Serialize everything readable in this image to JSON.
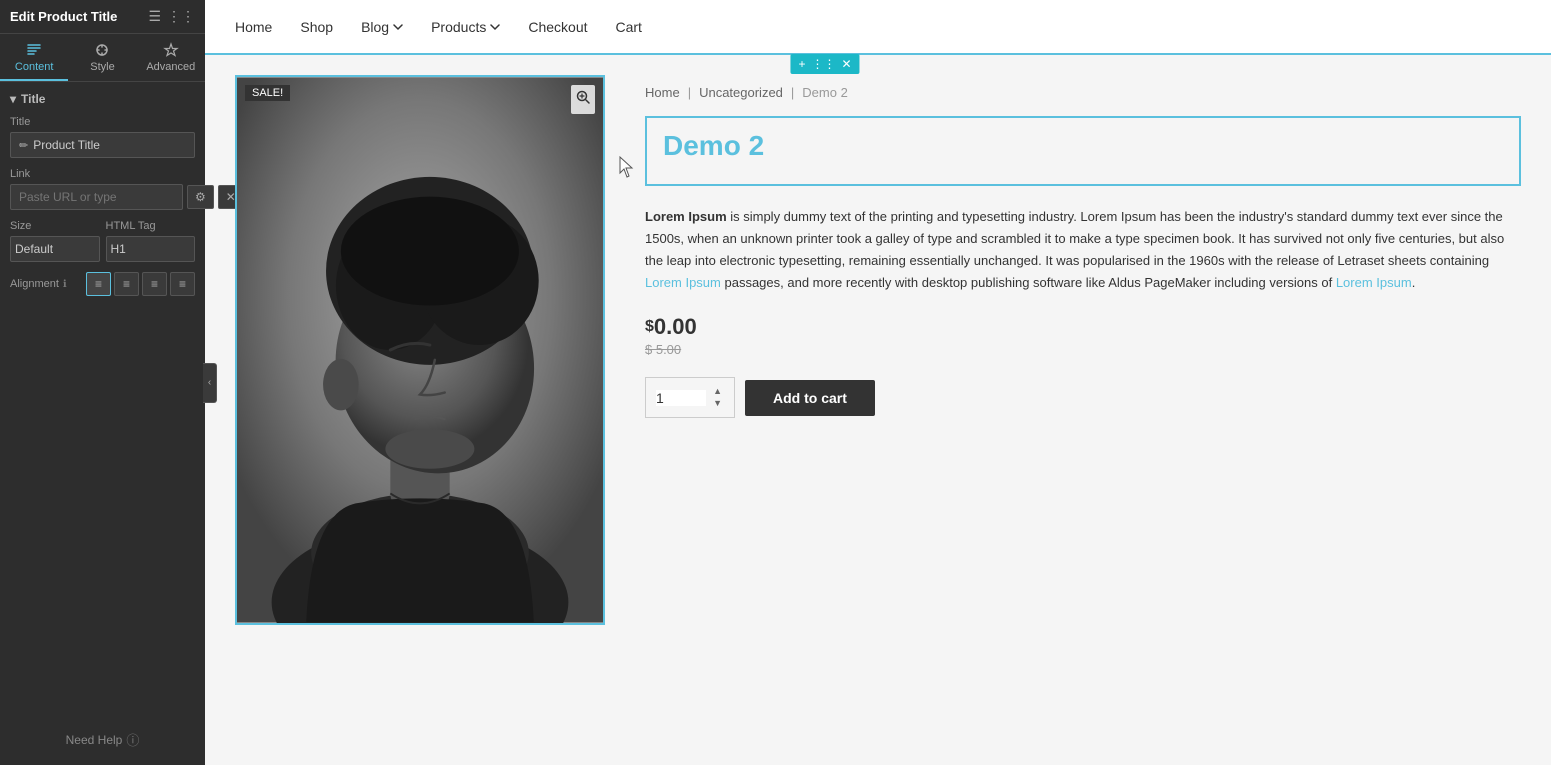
{
  "panel": {
    "header_title": "Edit Product Title",
    "tabs": [
      {
        "id": "content",
        "label": "Content",
        "active": true
      },
      {
        "id": "style",
        "label": "Style",
        "active": false
      },
      {
        "id": "advanced",
        "label": "Advanced",
        "active": false
      }
    ],
    "section_title": "Title",
    "fields": {
      "title_label": "Title",
      "title_placeholder": "Product Title",
      "title_icon": "✏",
      "link_label": "Link",
      "link_placeholder": "Paste URL or type",
      "size_label": "Size",
      "size_value": "Default",
      "html_tag_label": "HTML Tag",
      "html_tag_value": "H1",
      "alignment_label": "Alignment"
    },
    "need_help": "Need Help"
  },
  "nav": {
    "items": [
      {
        "label": "Home",
        "has_dropdown": false
      },
      {
        "label": "Shop",
        "has_dropdown": false
      },
      {
        "label": "Blog",
        "has_dropdown": true
      },
      {
        "label": "Products",
        "has_dropdown": true
      },
      {
        "label": "Checkout",
        "has_dropdown": false
      },
      {
        "label": "Cart",
        "has_dropdown": false
      }
    ]
  },
  "product": {
    "breadcrumb": {
      "home": "Home",
      "category": "Uncategorized",
      "current": "Demo 2"
    },
    "title": "Demo 2",
    "sale_badge": "SALE!",
    "description": {
      "intro_bold": "Lorem Ipsum",
      "intro_rest": " is simply dummy text of the printing and typesetting industry. Lorem Ipsum has been the industry's standard dummy text ever since the 1500s, when an unknown printer took a galley of type and scrambled it to make a type specimen book. It has survived not only five centuries, but also the leap into electronic typesetting, remaining essentially unchanged. It was popularised in the 1960s with the release of Letraset sheets containing Lorem Ipsum passages, and more recently with desktop publishing software like Aldus PageMaker including versions of Lorem Ipsum."
    },
    "price_current": "$ 0.00",
    "price_dollar": "$",
    "price_value": "0.00",
    "price_original": "$ 5.00",
    "qty": "1",
    "add_to_cart_label": "Add to cart"
  },
  "colors": {
    "accent": "#5bc0de",
    "panel_bg": "#2d2d2d",
    "dark_btn": "#333"
  }
}
